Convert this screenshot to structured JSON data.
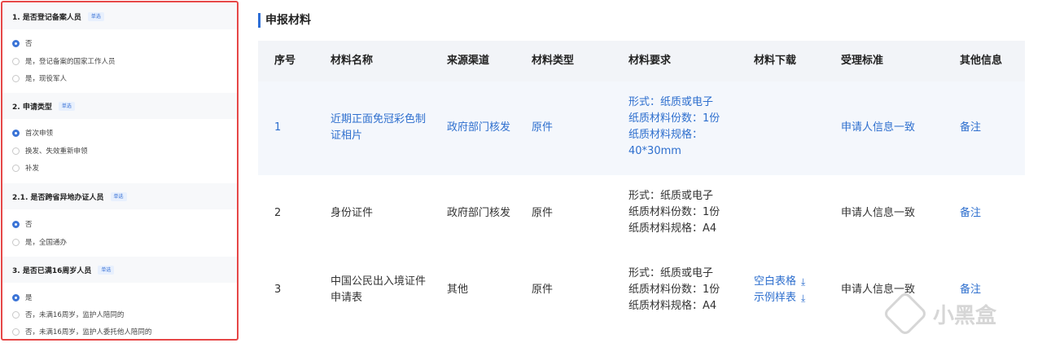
{
  "questions": [
    {
      "title": "1. 是否登记备案人员",
      "badge": "单选",
      "options": [
        {
          "label": "否",
          "selected": true
        },
        {
          "label": "是，登记备案的国家工作人员",
          "selected": false
        },
        {
          "label": "是，现役军人",
          "selected": false
        }
      ]
    },
    {
      "title": "2. 申请类型",
      "badge": "单选",
      "options": [
        {
          "label": "首次申领",
          "selected": true
        },
        {
          "label": "换发、失效重新申领",
          "selected": false
        },
        {
          "label": "补发",
          "selected": false
        }
      ]
    },
    {
      "title": "2.1. 是否跨省异地办证人员",
      "badge": "单选",
      "options": [
        {
          "label": "否",
          "selected": true
        },
        {
          "label": "是，全国通办",
          "selected": false
        }
      ]
    },
    {
      "title": "3. 是否已满16周岁人员",
      "badge": "单选",
      "options": [
        {
          "label": "是",
          "selected": true
        },
        {
          "label": "否，未满16周岁，监护人陪同的",
          "selected": false
        },
        {
          "label": "否，未满16周岁，监护人委托他人陪同的",
          "selected": false
        }
      ]
    }
  ],
  "materials": {
    "section_title": "申报材料",
    "columns": [
      "序号",
      "材料名称",
      "来源渠道",
      "材料类型",
      "材料要求",
      "材料下载",
      "受理标准",
      "其他信息"
    ],
    "rows": [
      {
        "index": "1",
        "name": [
          "近期正面免冠彩色制",
          "证相片"
        ],
        "source": "政府部门核发",
        "type": "原件",
        "requirements": [
          "形式：纸质或电子",
          "纸质材料份数：1份",
          "纸质材料规格：",
          "40*30mm"
        ],
        "downloads": [],
        "standard": "申请人信息一致",
        "other": "备注",
        "highlight": true
      },
      {
        "index": "2",
        "name": [
          "身份证件"
        ],
        "source": "政府部门核发",
        "type": "原件",
        "requirements": [
          "形式：纸质或电子",
          "纸质材料份数：1份",
          "纸质材料规格：A4"
        ],
        "downloads": [],
        "standard": "申请人信息一致",
        "other": "备注",
        "highlight": false
      },
      {
        "index": "3",
        "name": [
          "中国公民出入境证件",
          "申请表"
        ],
        "source": "其他",
        "type": "原件",
        "requirements": [
          "形式：纸质或电子",
          "纸质材料份数：1份",
          "纸质材料规格：A4"
        ],
        "downloads": [
          "空白表格",
          "示例样表"
        ],
        "standard": "申请人信息一致",
        "other": "备注",
        "highlight": false
      }
    ]
  },
  "watermark": {
    "text": "小黑盒"
  },
  "colors": {
    "accent": "#2e6fce",
    "frame": "#e64747"
  }
}
